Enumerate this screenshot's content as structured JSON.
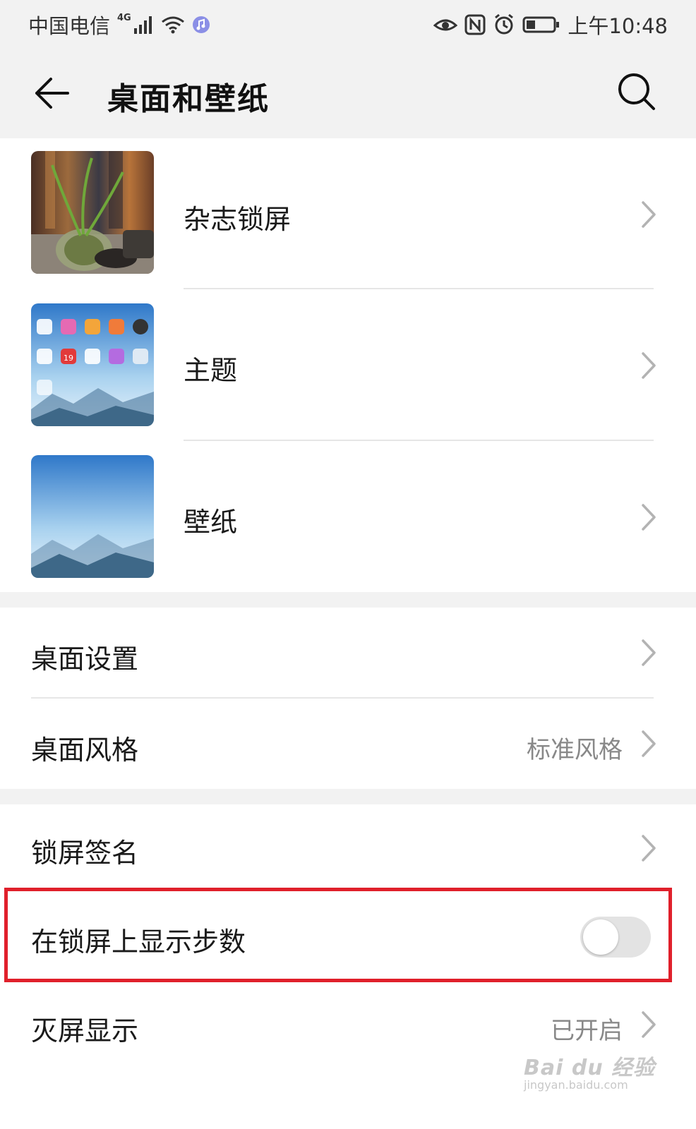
{
  "status_bar": {
    "carrier": "中国电信",
    "network": "4G",
    "time": "上午10:48"
  },
  "header": {
    "title": "桌面和壁纸"
  },
  "media_items": [
    {
      "label": "杂志锁屏"
    },
    {
      "label": "主题"
    },
    {
      "label": "壁纸"
    }
  ],
  "theme_thumb": {
    "date_label": "19"
  },
  "desktop_group": [
    {
      "label": "桌面设置",
      "value": ""
    },
    {
      "label": "桌面风格",
      "value": "标准风格"
    }
  ],
  "lock_group": {
    "signature": {
      "label": "锁屏签名"
    },
    "show_steps": {
      "label": "在锁屏上显示步数",
      "enabled": false
    },
    "aod": {
      "label": "灭屏显示",
      "value": "已开启"
    }
  },
  "watermark": {
    "brand": "Bai du 经验",
    "domain": "jingyan.baidu.com"
  },
  "colors": {
    "background": "#ffffff",
    "bar_bg": "#f2f2f2",
    "highlight": "#e0202b",
    "toggle_off": "#e3e3e3"
  }
}
